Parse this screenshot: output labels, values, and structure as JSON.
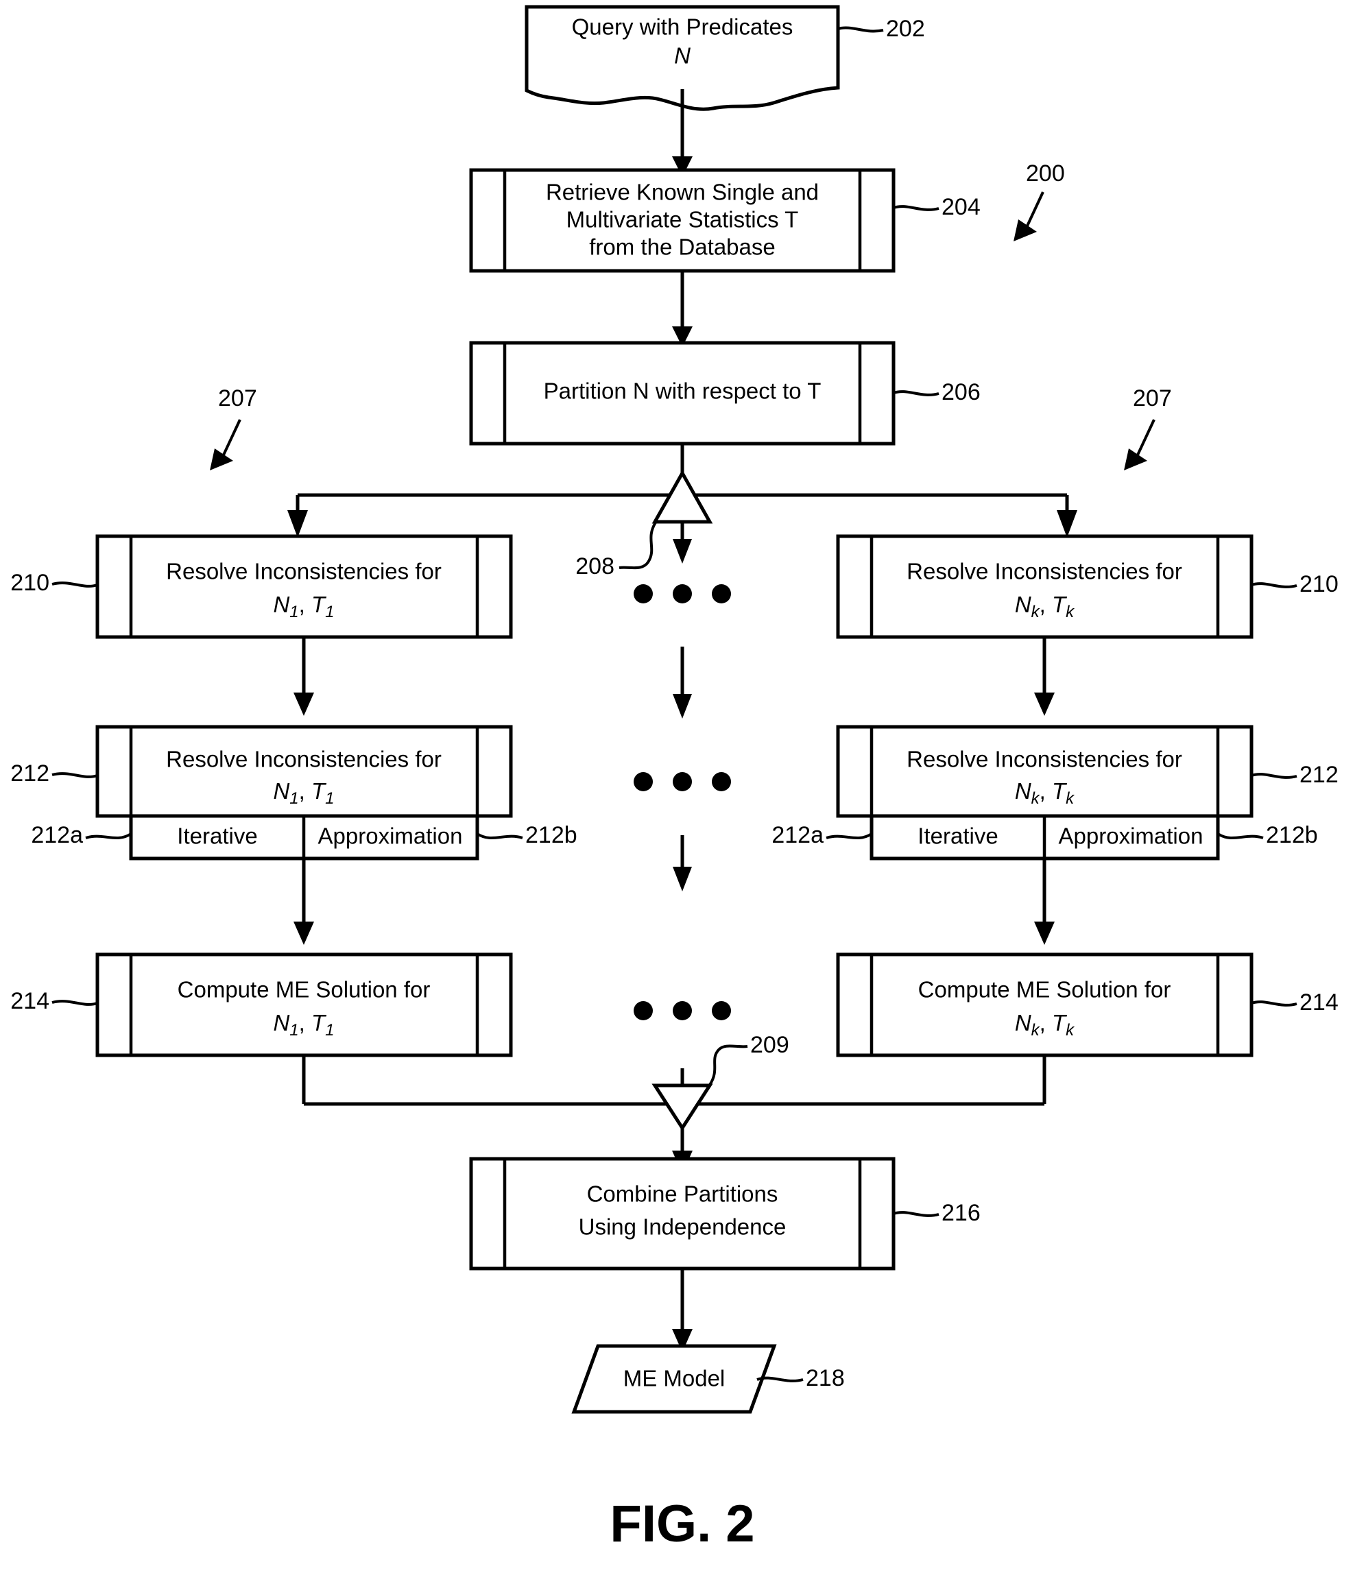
{
  "figure": {
    "caption": "FIG. 2",
    "overall_ref": "200"
  },
  "nodes": {
    "query": {
      "ref": "202",
      "shape": "document",
      "line1": "Query with Predicates",
      "line2": "N"
    },
    "retrieve": {
      "ref": "204",
      "shape": "predefined-process",
      "line1": "Retrieve Known Single and",
      "line2": "Multivariate Statistics T",
      "line3": "from the Database"
    },
    "partition": {
      "ref": "206",
      "shape": "predefined-process",
      "line1": "Partition N with respect to T"
    },
    "fork": {
      "ref": "208",
      "shape": "fork-triangle"
    },
    "join": {
      "ref": "209",
      "shape": "join-triangle"
    },
    "branch_arrows": {
      "ref": "207"
    },
    "resolve_left": {
      "ref": "210",
      "shape": "predefined-process",
      "line1": "Resolve Inconsistencies for",
      "line2_base_n": "N",
      "line2_sub_n": "1",
      "line2_base_t": "T",
      "line2_sub_t": "1"
    },
    "resolve_right": {
      "ref": "210",
      "shape": "predefined-process",
      "line1": "Resolve Inconsistencies for",
      "line2_base_n": "N",
      "line2_sub_n": "k",
      "line2_base_t": "T",
      "line2_sub_t": "k"
    },
    "resolve2_left": {
      "ref": "212",
      "shape": "predefined-process",
      "line1": "Resolve Inconsistencies for",
      "line2_base_n": "N",
      "line2_sub_n": "1",
      "line2_base_t": "T",
      "line2_sub_t": "1",
      "sub_a_ref": "212a",
      "sub_a_label": "Iterative",
      "sub_b_ref": "212b",
      "sub_b_label": "Approximation"
    },
    "resolve2_right": {
      "ref": "212",
      "shape": "predefined-process",
      "line1": "Resolve Inconsistencies for",
      "line2_base_n": "N",
      "line2_sub_n": "k",
      "line2_base_t": "T",
      "line2_sub_t": "k",
      "sub_a_ref": "212a",
      "sub_a_label": "Iterative",
      "sub_b_ref": "212b",
      "sub_b_label": "Approximation"
    },
    "compute_left": {
      "ref": "214",
      "shape": "predefined-process",
      "line1": "Compute ME Solution for",
      "line2_base_n": "N",
      "line2_sub_n": "1",
      "line2_base_t": "T",
      "line2_sub_t": "1"
    },
    "compute_right": {
      "ref": "214",
      "shape": "predefined-process",
      "line1": "Compute ME Solution for",
      "line2_base_n": "N",
      "line2_sub_n": "k",
      "line2_base_t": "T",
      "line2_sub_t": "k"
    },
    "combine": {
      "ref": "216",
      "shape": "predefined-process",
      "line1": "Combine Partitions",
      "line2": "Using Independence"
    },
    "me_model": {
      "ref": "218",
      "shape": "parallelogram",
      "line1": "ME Model"
    }
  },
  "ellipsis": {
    "glyph": "●",
    "rows": [
      "row-1",
      "row-2",
      "row-3"
    ]
  },
  "colors": {
    "line": "#000000",
    "fill": "#ffffff",
    "background": "#ffffff"
  }
}
